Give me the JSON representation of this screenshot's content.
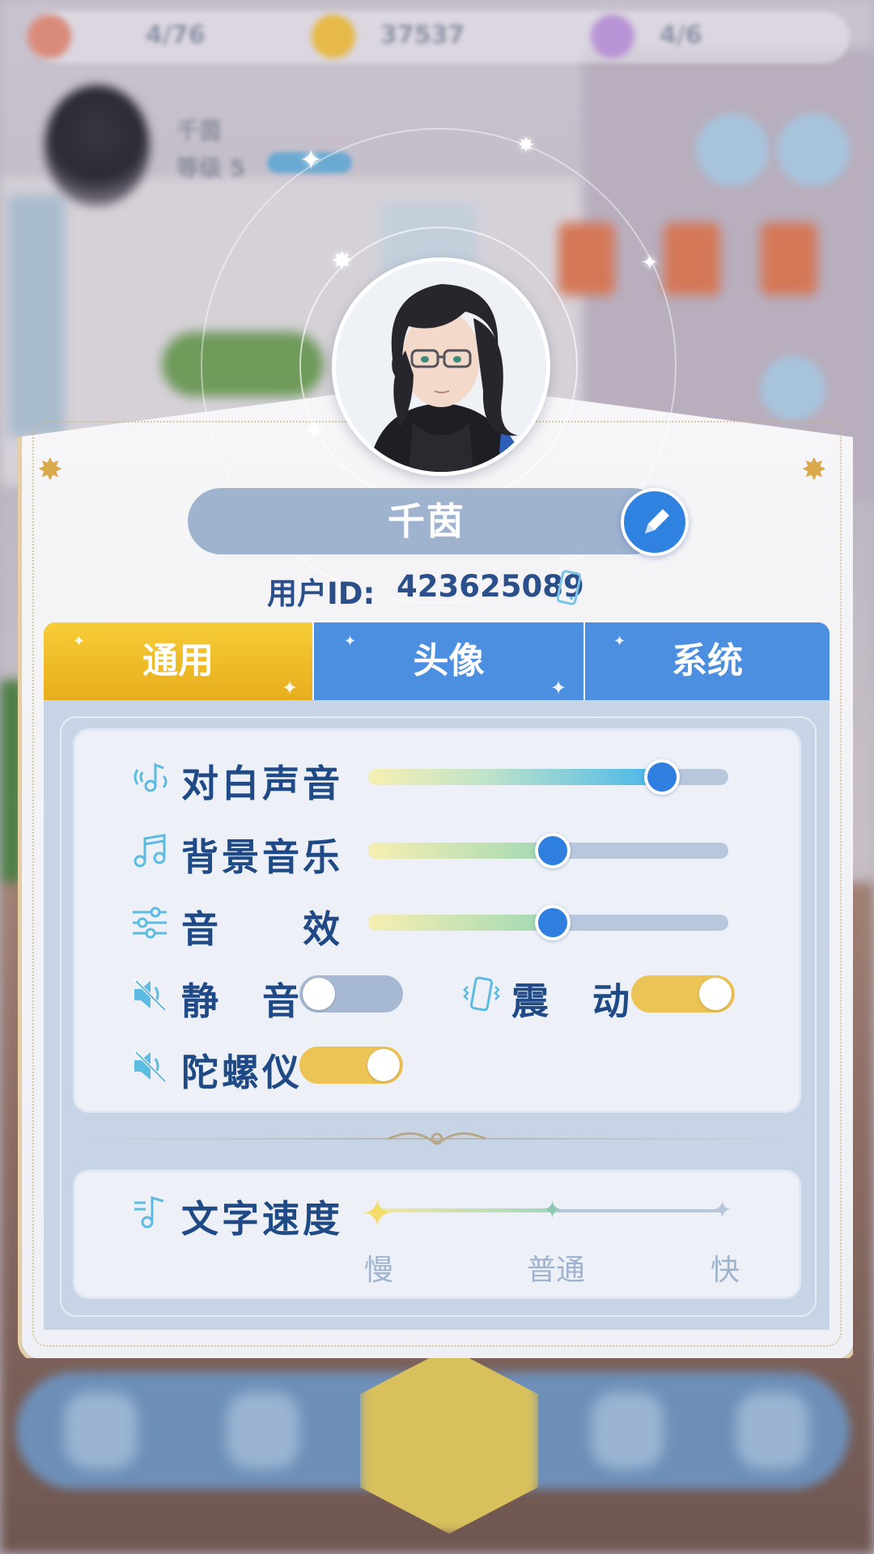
{
  "top_bar": {
    "stat1": "4/76",
    "stat2": "37537",
    "stat3": "4/6"
  },
  "profile_header": {
    "name": "千茵",
    "level_label": "等级 5"
  },
  "panel": {
    "username": "千茵",
    "user_id_label": "用户ID:",
    "user_id_value": "423625089"
  },
  "tabs": [
    {
      "label": "通用",
      "active": true
    },
    {
      "label": "头像",
      "active": false
    },
    {
      "label": "系统",
      "active": false
    }
  ],
  "audio": {
    "dialogue": {
      "label": "对白声音",
      "value": 0.82
    },
    "bgm": {
      "label": "背景音乐",
      "value": 0.51
    },
    "sfx": {
      "label": "音　　效",
      "value": 0.51
    }
  },
  "toggles": {
    "mute": {
      "label": "静　音",
      "on": false
    },
    "vibrate": {
      "label": "震　动",
      "on": true
    },
    "gyro": {
      "label": "陀螺仪",
      "on": true
    }
  },
  "text_speed": {
    "label": "文字速度",
    "options": [
      "慢",
      "普通",
      "快"
    ],
    "selected": "慢"
  },
  "colors": {
    "accent_blue": "#2f7fe0",
    "tab_active": "#f2c12e",
    "tab_inactive": "#4c8fe0",
    "label_blue": "#1f4a86",
    "toggle_on": "#ecc355",
    "toggle_off": "#a7b9d2"
  }
}
